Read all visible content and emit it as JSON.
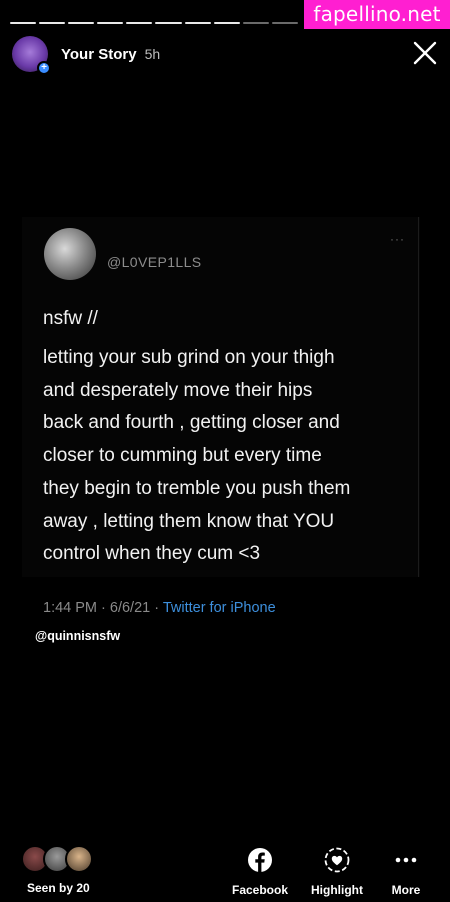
{
  "watermark": "fapellino.net",
  "story": {
    "title": "Your Story",
    "time": "5h"
  },
  "tweet": {
    "handle": "@L0VEP1LLS",
    "title": "nsfw //",
    "lines": [
      "letting your sub grind on your thigh",
      "and desperately move their hips",
      "back and fourth , getting closer and",
      "closer to cumming but every time",
      "they begin to tremble you push them",
      "away , letting them know that YOU",
      "control when they cum <3"
    ],
    "meta_time": "1:44 PM · 6/6/21 · ",
    "meta_source": "Twitter for iPhone",
    "more_dots": "···"
  },
  "mention": "@quinnisnsfw",
  "footer": {
    "seen": "Seen by 20",
    "facebook": "Facebook",
    "highlight": "Highlight",
    "more": "More"
  },
  "icons": {
    "close": "close-icon",
    "facebook": "facebook-icon",
    "highlight": "highlight-heart-icon",
    "more": "more-dots-icon"
  }
}
